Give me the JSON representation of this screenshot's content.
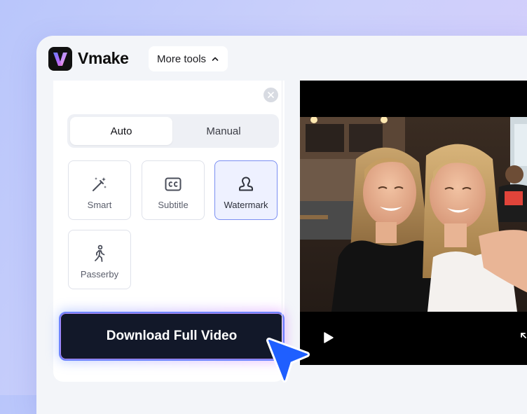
{
  "app": {
    "name": "Vmake",
    "logo_letter": "V",
    "more_tools_label": "More tools"
  },
  "panel": {
    "tabs": [
      {
        "label": "Auto",
        "active": true
      },
      {
        "label": "Manual",
        "active": false
      }
    ],
    "tools": [
      {
        "label": "Smart",
        "icon": "magic-wand-icon",
        "selected": false
      },
      {
        "label": "Subtitle",
        "icon": "cc-icon",
        "selected": false
      },
      {
        "label": "Watermark",
        "icon": "stamp-icon",
        "selected": true
      },
      {
        "label": "Passerby",
        "icon": "walking-person-icon",
        "selected": false
      }
    ],
    "download_label": "Download Full Video"
  },
  "video": {
    "scene": "selfie-two-women-in-cafe",
    "controls": [
      "play-icon",
      "expand-icon"
    ]
  },
  "colors": {
    "accent": "#6e85ff",
    "button_bg": "#121829",
    "cursor": "#1f5fff",
    "selected_bg": "#eef1ff"
  }
}
